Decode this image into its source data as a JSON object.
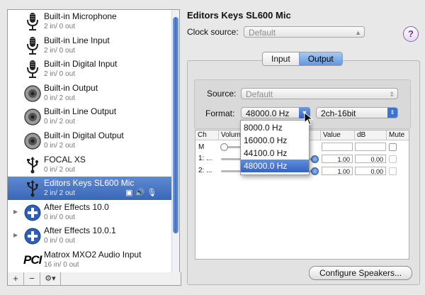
{
  "device_list": [
    {
      "name": "Built-in Microphone",
      "channels": "2 in/ 0 out",
      "icon": "microphone-icon"
    },
    {
      "name": "Built-in Line Input",
      "channels": "2 in/ 0 out",
      "icon": "microphone-icon"
    },
    {
      "name": "Built-in Digital Input",
      "channels": "2 in/ 0 out",
      "icon": "microphone-icon"
    },
    {
      "name": "Built-in Output",
      "channels": "0 in/ 2 out",
      "icon": "speaker-icon"
    },
    {
      "name": "Built-in Line Output",
      "channels": "0 in/ 2 out",
      "icon": "speaker-icon"
    },
    {
      "name": "Built-in Digital Output",
      "channels": "0 in/ 2 out",
      "icon": "speaker-icon"
    },
    {
      "name": "FOCAL XS",
      "channels": "0 in/ 2 out",
      "icon": "usb-icon"
    },
    {
      "name": "Editors Keys SL600 Mic",
      "channels": "2 in/ 2 out",
      "icon": "usb-icon"
    },
    {
      "name": "After Effects 10.0",
      "channels": "0 in/ 0 out",
      "icon": "aggregate-plus-icon"
    },
    {
      "name": "After Effects 10.0.1",
      "channels": "0 in/ 0 out",
      "icon": "aggregate-plus-icon"
    },
    {
      "name": "Matrox MXO2 Audio Input",
      "channels": "16 in/ 0 out",
      "icon": "pci-icon"
    }
  ],
  "selected_index": 7,
  "toolbar": {
    "add": "+",
    "remove": "−",
    "action": "⚙▾"
  },
  "device_title": "Editors Keys SL600 Mic",
  "clock": {
    "label": "Clock source:",
    "value": "Default"
  },
  "help": "?",
  "tabs": {
    "input": "Input",
    "output": "Output",
    "active": "output"
  },
  "source": {
    "label": "Source:",
    "value": "Default"
  },
  "format": {
    "label": "Format:",
    "value": "48000.0 Hz",
    "bits": "2ch-16bit",
    "options": [
      "8000.0 Hz",
      "16000.0 Hz",
      "44100.0 Hz",
      "48000.0 Hz"
    ],
    "selected": "48000.0 Hz"
  },
  "table": {
    "headers": {
      "ch": "Ch",
      "volume": "Volum",
      "value": "Value",
      "db": "dB",
      "mute": "Mute"
    },
    "rows": [
      {
        "ch": "M",
        "value": "",
        "db": ""
      },
      {
        "ch": "1: ...",
        "value": "1.00",
        "db": "0.00"
      },
      {
        "ch": "2: ...",
        "value": "1.00",
        "db": "0.00"
      }
    ]
  },
  "configure_button": "Configure Speakers..."
}
